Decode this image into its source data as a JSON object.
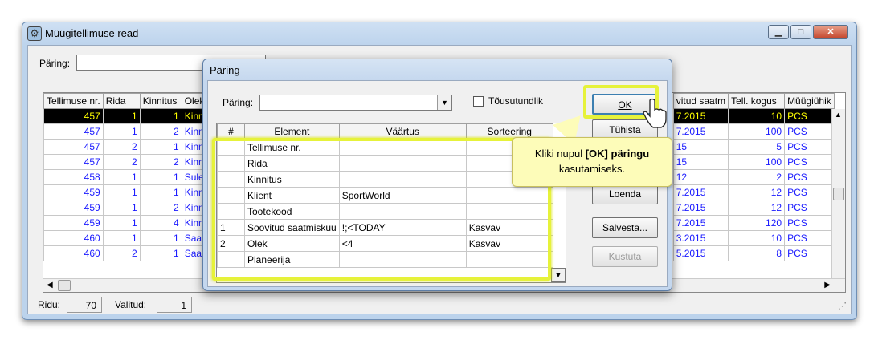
{
  "window": {
    "title": "Müügitellimuse read"
  },
  "query_bar": {
    "label": "Päring:",
    "value": ""
  },
  "main_grid": {
    "left_headers": [
      "Tellimuse nr.",
      "Rida",
      "Kinnitus",
      "Olek"
    ],
    "right_headers": [
      "vitud saatm",
      "Tell. kogus",
      "Müügiühik"
    ],
    "rows": [
      {
        "order": "457",
        "line": "1",
        "conf": "1",
        "state": "Kinn",
        "date": "7.2015",
        "qty": "10",
        "unit": "PCS"
      },
      {
        "order": "457",
        "line": "1",
        "conf": "2",
        "state": "Kinn",
        "date": "7.2015",
        "qty": "100",
        "unit": "PCS"
      },
      {
        "order": "457",
        "line": "2",
        "conf": "1",
        "state": "Kinn",
        "date": "15",
        "qty": "5",
        "unit": "PCS"
      },
      {
        "order": "457",
        "line": "2",
        "conf": "2",
        "state": "Kinn",
        "date": "15",
        "qty": "100",
        "unit": "PCS"
      },
      {
        "order": "458",
        "line": "1",
        "conf": "1",
        "state": "Sule",
        "date": "12",
        "qty": "2",
        "unit": "PCS"
      },
      {
        "order": "459",
        "line": "1",
        "conf": "1",
        "state": "Kinn",
        "date": "7.2015",
        "qty": "12",
        "unit": "PCS"
      },
      {
        "order": "459",
        "line": "1",
        "conf": "2",
        "state": "Kinn",
        "date": "7.2015",
        "qty": "12",
        "unit": "PCS"
      },
      {
        "order": "459",
        "line": "1",
        "conf": "4",
        "state": "Kinn",
        "date": "7.2015",
        "qty": "120",
        "unit": "PCS"
      },
      {
        "order": "460",
        "line": "1",
        "conf": "1",
        "state": "Saat",
        "date": "3.2015",
        "qty": "10",
        "unit": "PCS"
      },
      {
        "order": "460",
        "line": "2",
        "conf": "1",
        "state": "Saat",
        "date": "5.2015",
        "qty": "8",
        "unit": "PCS"
      }
    ]
  },
  "status": {
    "rows_label": "Ridu:",
    "rows_value": "70",
    "selected_label": "Valitud:",
    "selected_value": "1"
  },
  "dialog": {
    "title": "Päring",
    "query_label": "Päring:",
    "query_value": "",
    "ascending_label": "Tõusutundlik",
    "grid_headers": [
      "#",
      "Element",
      "Väärtus",
      "Sorteering"
    ],
    "grid_rows": [
      {
        "n": "",
        "element": "Tellimuse nr.",
        "value": "",
        "sort": ""
      },
      {
        "n": "",
        "element": "Rida",
        "value": "",
        "sort": ""
      },
      {
        "n": "",
        "element": "Kinnitus",
        "value": "",
        "sort": ""
      },
      {
        "n": "",
        "element": "Klient",
        "value": "SportWorld",
        "sort": ""
      },
      {
        "n": "",
        "element": "Tootekood",
        "value": "",
        "sort": ""
      },
      {
        "n": "1",
        "element": "Soovitud saatmiskuu",
        "value": "!;<TODAY",
        "sort": "Kasvav"
      },
      {
        "n": "2",
        "element": "Olek",
        "value": "<4",
        "sort": "Kasvav"
      },
      {
        "n": "",
        "element": "Planeerija",
        "value": "",
        "sort": ""
      }
    ],
    "buttons": {
      "ok": "OK",
      "cancel": "Tühista",
      "load": "Loenda",
      "save": "Salvesta...",
      "delete": "Kustuta"
    }
  },
  "tooltip": {
    "line1_pre": "Kliki nupul ",
    "line1_bracket_open": "[",
    "line1_bold": "OK",
    "line1_bracket_close": "]",
    "line1_bold2": " päringu",
    "line2": "kasutamiseks."
  },
  "colors": {
    "highlight": "#e6f23a",
    "selected_row_bg": "#000000",
    "selected_row_fg": "#ffff00",
    "number_blue": "#1a1aff"
  }
}
